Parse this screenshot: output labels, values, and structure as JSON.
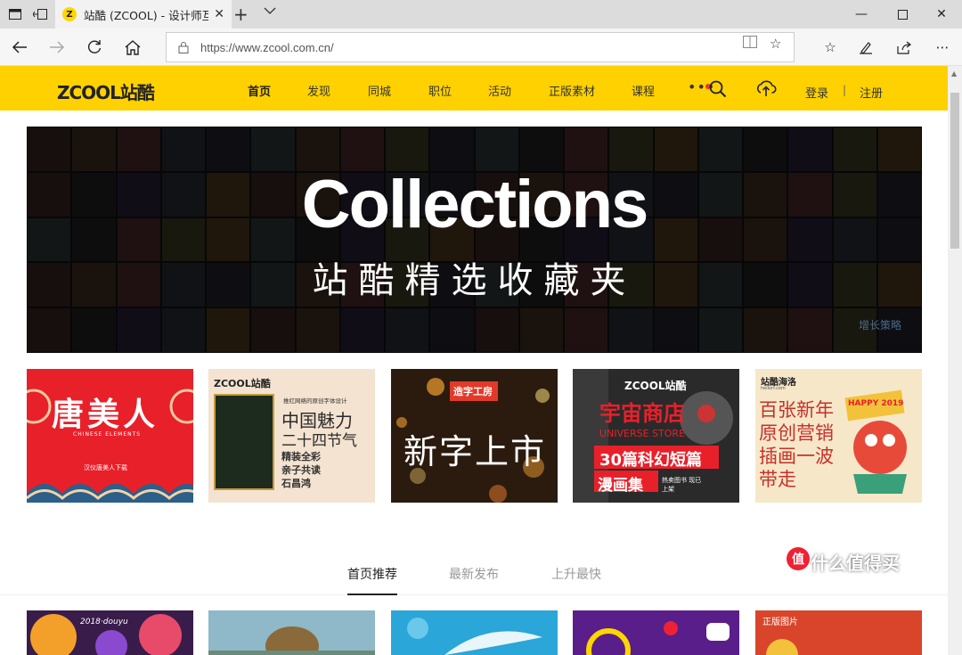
{
  "browser": {
    "tab_title": "站酷 (ZCOOL) - 设计师互",
    "favicon_letter": "Z",
    "url": "https://www.zcool.com.cn/"
  },
  "site": {
    "logo_text": "ZCOOL站酷",
    "nav": [
      "首页",
      "发现",
      "同城",
      "职位",
      "活动",
      "正版素材",
      "课程"
    ],
    "nav_active": "首页",
    "more_dots": "•••",
    "login": "登录",
    "separator": "|",
    "register": "注册",
    "accent_color": "#ffd100"
  },
  "banner": {
    "title": "Collections",
    "subtitle": "站酷精选收藏夹",
    "corner_text": "增长策略"
  },
  "cards": [
    {
      "lines": [
        "唐美人",
        "CHINESE ELEMENTS",
        "汉仪唐美人下载"
      ],
      "bg": "#e8202a"
    },
    {
      "lines": [
        "ZCOOL站酷",
        "中国魅力",
        "二十四节气",
        "精装全彩",
        "亲子共读",
        "石昌鸿",
        "推红网络的原创字体设计"
      ],
      "bg": "#f3e3d0"
    },
    {
      "lines": [
        "造字工房",
        "新字上市"
      ],
      "bg": "#2b1a0e"
    },
    {
      "lines": [
        "ZCOOL站酷",
        "宇宙商店",
        "UNIVERSE STORE",
        "30篇科幻短篇",
        "漫画集",
        "热卖图书 现已上架"
      ],
      "bg": "#2a2a2a"
    },
    {
      "lines": [
        "站酷海洛",
        "百张新年",
        "原创营销",
        "插画一波",
        "带走",
        "HAPPY 2019",
        "hellorf.com"
      ],
      "bg": "#f6e7c8"
    }
  ],
  "feed_tabs": [
    "首页推荐",
    "最新发布",
    "上升最快"
  ],
  "feed_active": "首页推荐",
  "thumbs": [
    {
      "label": "2018·douyu",
      "bg": "#3a1c4a"
    },
    {
      "label": "",
      "bg": "#8fb8c8"
    },
    {
      "label": "",
      "bg": "#2aa6d8"
    },
    {
      "label": "",
      "bg": "#5a1e8a"
    },
    {
      "label": "正版图片",
      "bg": "#d9452a"
    }
  ],
  "watermark": {
    "text": "什么值得买",
    "icon": "值"
  }
}
